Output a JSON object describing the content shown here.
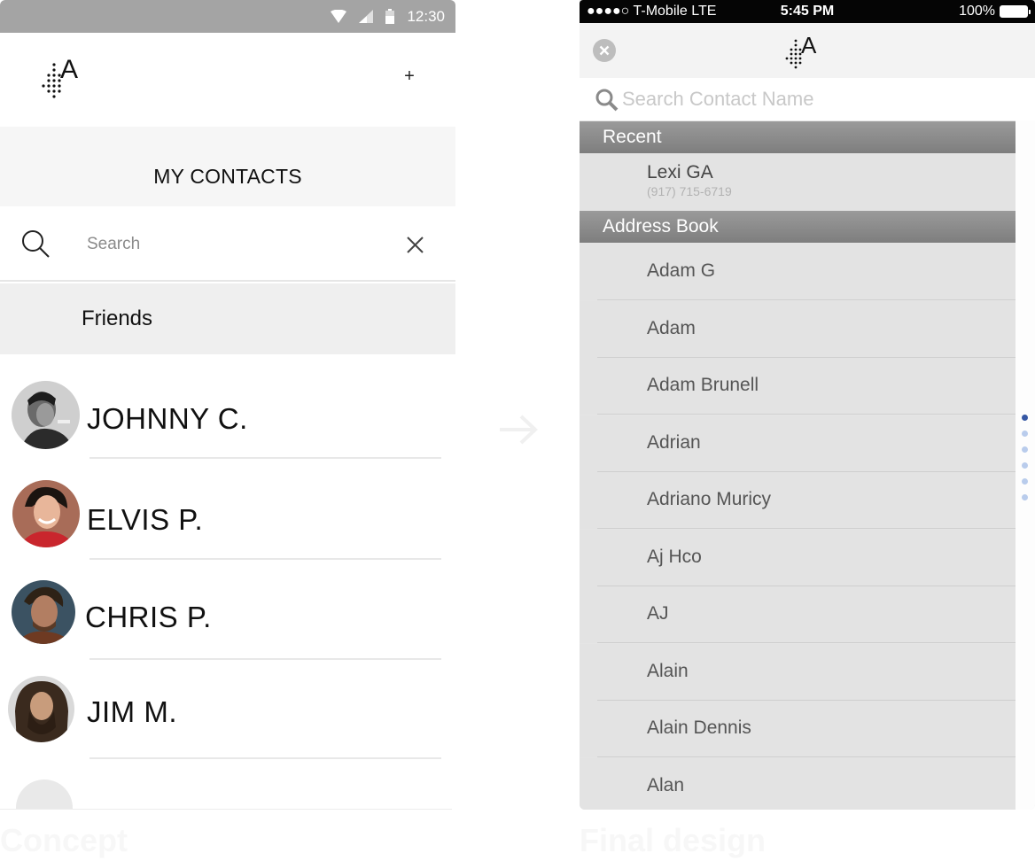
{
  "concept": {
    "status_time": "12:30",
    "logo_letter": "A",
    "add_label": "+",
    "title": "MY CONTACTS",
    "search_placeholder": "Search",
    "section_label": "Friends",
    "contacts": [
      {
        "name": "JOHNNY C."
      },
      {
        "name": "ELVIS P."
      },
      {
        "name": "CHRIS P."
      },
      {
        "name": "JIM M."
      }
    ],
    "caption": "Concept"
  },
  "final": {
    "carrier": "●●●●○ T-Mobile  LTE",
    "time": "5:45 PM",
    "battery": "100%",
    "logo_letter": "A",
    "search_placeholder": "Search Contact Name",
    "recent_header": "Recent",
    "recent": {
      "name": "Lexi GA",
      "phone": "(917) 715-6719"
    },
    "address_header": "Address Book",
    "address_book": [
      "Adam  G",
      "Adam",
      "Adam Brunell",
      "Adrian",
      "Adriano Muricy",
      "Aj Hco",
      "AJ",
      "Alain",
      "Alain Dennis",
      "Alan"
    ],
    "caption": "Final design"
  },
  "colors": {
    "android_status": "#a4a4a4",
    "section_header": "#8c8c8c",
    "rail_active_dot": "#3557a4",
    "rail_dot": "#b9ccec"
  }
}
